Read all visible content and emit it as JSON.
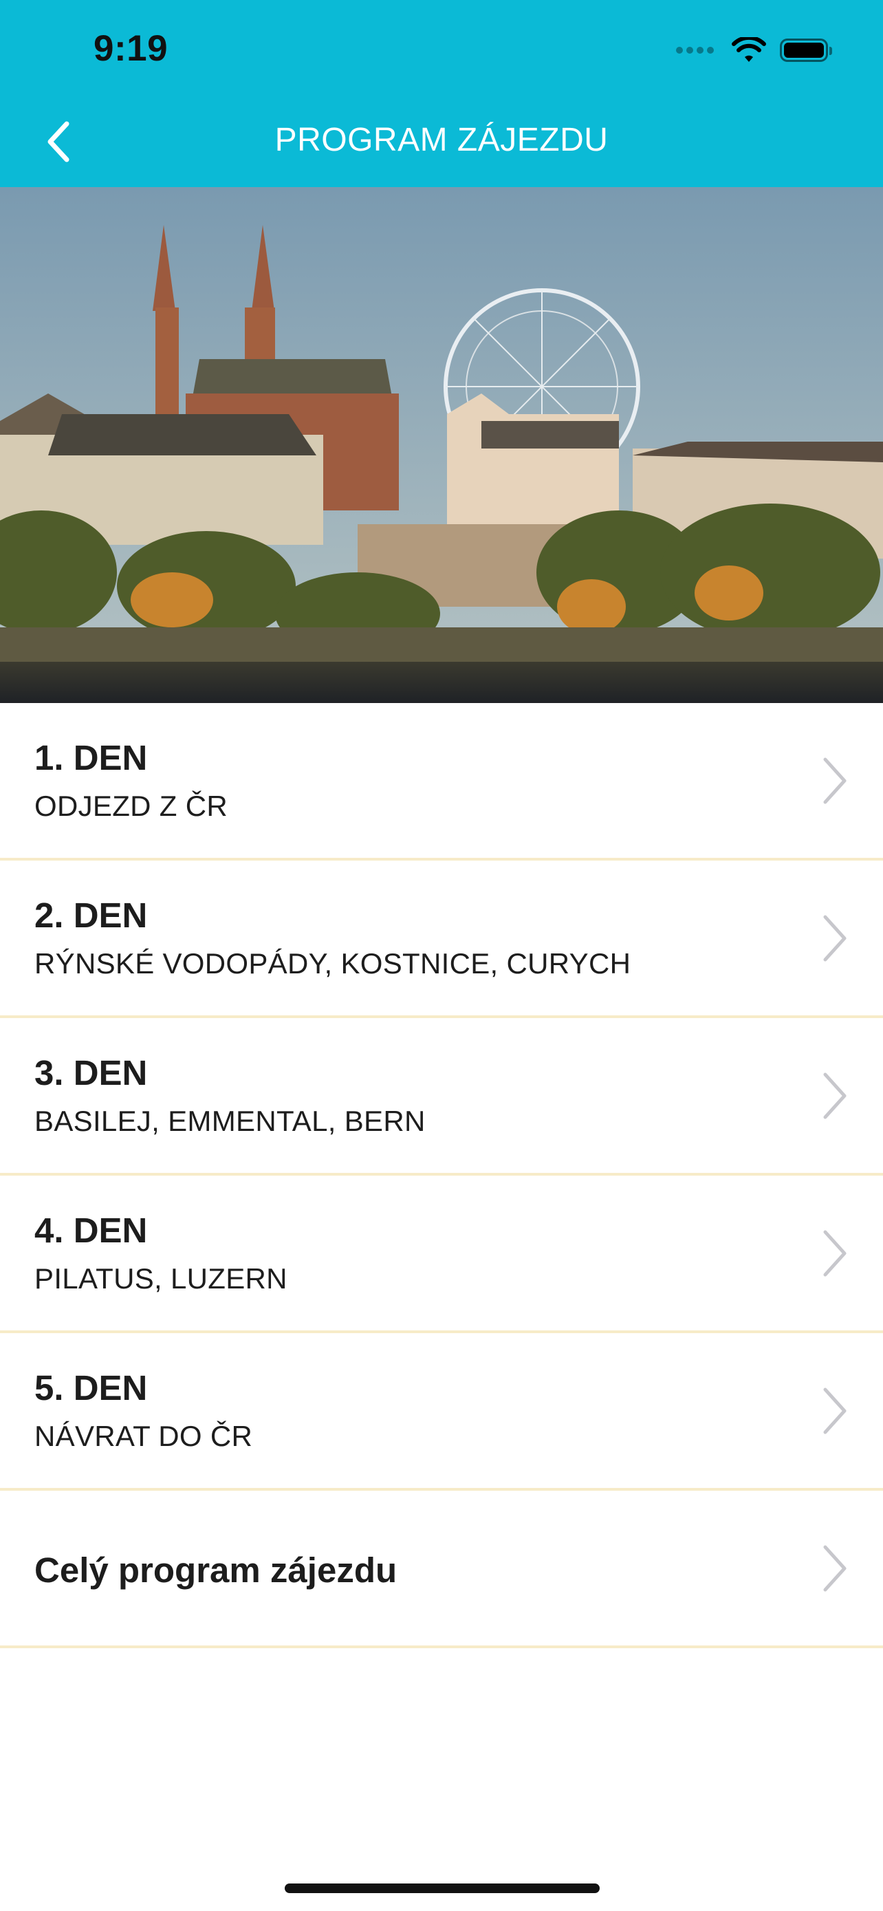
{
  "status_bar": {
    "time": "9:19",
    "icons": [
      "cellular-signal-icon",
      "wifi-icon",
      "battery-icon"
    ]
  },
  "header": {
    "title": "PROGRAM ZÁJEZDU",
    "back_icon": "chevron-left-icon",
    "background_color": "#0bbad6"
  },
  "hero": {
    "description_icon": "city-photo"
  },
  "days": [
    {
      "title": "1. DEN",
      "subtitle": "ODJEZD Z ČR"
    },
    {
      "title": "2. DEN",
      "subtitle": "RÝNSKÉ VODOPÁDY, KOSTNICE, CURYCH"
    },
    {
      "title": "3. DEN",
      "subtitle": "BASILEJ, EMMENTAL, BERN"
    },
    {
      "title": "4. DEN",
      "subtitle": "PILATUS, LUZERN"
    },
    {
      "title": "5. DEN",
      "subtitle": "NÁVRAT DO ČR"
    }
  ],
  "full_program": {
    "title": "Celý program zájezdu"
  },
  "colors": {
    "accent": "#0bbad6",
    "divider": "#f7ebc8",
    "chevron": "#c7c7cc"
  }
}
